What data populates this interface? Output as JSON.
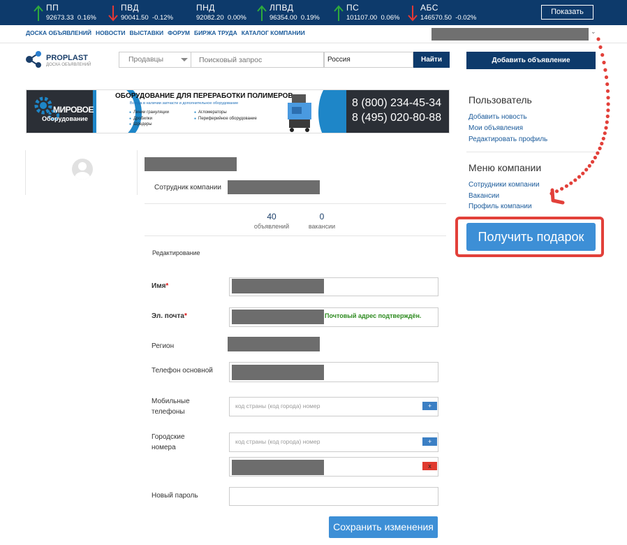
{
  "colors": {
    "header_bg": "#0d3a6b",
    "up": "#2eaa3c",
    "down": "#e53935",
    "link": "#1a5a9a",
    "accent": "#3d8fd6",
    "highlight": "#e2403a",
    "confirm": "#2e8b20"
  },
  "ticker": [
    {
      "name": "ПП",
      "value": "92673.33",
      "change": "0.16%",
      "trend": "up"
    },
    {
      "name": "ПВД",
      "value": "90041.50",
      "change": "-0.12%",
      "trend": "down"
    },
    {
      "name": "ПНД",
      "value": "92082.20",
      "change": "0.00%",
      "trend": "none"
    },
    {
      "name": "ЛПВД",
      "value": "96354.00",
      "change": "0.19%",
      "trend": "up"
    },
    {
      "name": "ПС",
      "value": "101107.00",
      "change": "0.06%",
      "trend": "up"
    },
    {
      "name": "АБС",
      "value": "146570.50",
      "change": "-0.02%",
      "trend": "down"
    }
  ],
  "ticker_show_label": "Показать",
  "nav": [
    "ДОСКА ОБЪЯВЛЕНИЙ",
    "НОВОСТИ",
    "ВЫСТАВКИ",
    "ФОРУМ",
    "БИРЖА ТРУДА",
    "КАТАЛОГ КОМПАНИИ"
  ],
  "logo": {
    "title": "PROPLAST",
    "subtitle": "ДОСКА ОБЪЯВЛЕНИЙ"
  },
  "search": {
    "category": "Продавцы",
    "placeholder": "Поисковый запрос",
    "region": "Россия",
    "button": "Найти"
  },
  "add_ad_label": "Добавить объявление",
  "banner": {
    "brand_line1": "МИРОВОЕ",
    "brand_line2": "Оборудование",
    "title": "ОБОРУДОВАНИЕ ДЛЯ ПЕРЕРАБОТКИ ПОЛИМЕРОВ",
    "subtitle": "Всегда в наличии запчасти и дополнительное оборудование",
    "list_left": [
      "Линии грануляции",
      "Дробилки",
      "Шредеры"
    ],
    "list_right": [
      "Агломераторы",
      "Периферийное оборудование"
    ],
    "phone1": "8 (800) 234-45-34",
    "phone2": "8 (495) 020-80-88"
  },
  "profile": {
    "employee_label": "Сотрудник компании",
    "stats": [
      {
        "value": "40",
        "label": "объявлений"
      },
      {
        "value": "0",
        "label": "вакансии"
      }
    ]
  },
  "form": {
    "section_title": "Редактирование",
    "name_label": "Имя",
    "email_label": "Эл. почта",
    "email_confirmed": "Почтовый адрес подтверждён.",
    "region_label": "Регион",
    "phone_main_label": "Телефон основной",
    "mobile_label": "Мобильные телефоны",
    "city_label": "Городские номера",
    "phone_placeholder": "код страны (код города) номер",
    "plus": "+",
    "remove": "x",
    "password_label": "Новый пароль",
    "save_label": "Сохранить изменения"
  },
  "sidebar": {
    "user_heading": "Пользователь",
    "user_links": [
      "Добавить новость",
      "Мои объявления",
      "Редактировать профиль"
    ],
    "company_heading": "Меню компании",
    "company_links": [
      "Сотрудники компании",
      "Вакансии",
      "Профиль компании"
    ]
  },
  "gift_label": "Получить подарок"
}
